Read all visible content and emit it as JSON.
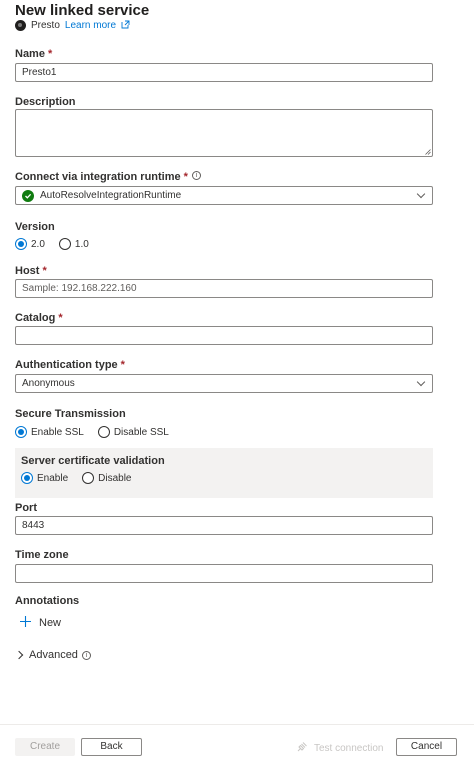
{
  "header": {
    "title": "New linked service",
    "service_name": "Presto",
    "learn_more": "Learn more"
  },
  "fields": {
    "name": {
      "label": "Name",
      "required": "*",
      "value": "Presto1"
    },
    "description": {
      "label": "Description",
      "value": ""
    },
    "runtime": {
      "label": "Connect via integration runtime",
      "required": "*",
      "info": "i",
      "value": "AutoResolveIntegrationRuntime",
      "status_color": "#107c10"
    },
    "version": {
      "label": "Version",
      "options": [
        "2.0",
        "1.0"
      ],
      "selected": "2.0"
    },
    "host": {
      "label": "Host",
      "required": "*",
      "placeholder": "Sample: 192.168.222.160",
      "value": ""
    },
    "catalog": {
      "label": "Catalog",
      "required": "*",
      "value": ""
    },
    "auth_type": {
      "label": "Authentication type",
      "required": "*",
      "value": "Anonymous"
    },
    "secure_transmission": {
      "label": "Secure Transmission",
      "options": [
        "Enable SSL",
        "Disable SSL"
      ],
      "selected": "Enable SSL"
    },
    "cert_validation": {
      "label": "Server certificate validation",
      "options": [
        "Enable",
        "Disable"
      ],
      "selected": "Enable"
    },
    "port": {
      "label": "Port",
      "value": "8443"
    },
    "time_zone": {
      "label": "Time zone",
      "value": ""
    },
    "annotations": {
      "label": "Annotations",
      "new_label": "New"
    },
    "advanced": {
      "label": "Advanced",
      "info": "i"
    }
  },
  "footer": {
    "create": "Create",
    "back": "Back",
    "test_connection": "Test connection",
    "cancel": "Cancel"
  },
  "colors": {
    "accent": "#0078d4",
    "required": "#a4262c",
    "success": "#107c10"
  }
}
